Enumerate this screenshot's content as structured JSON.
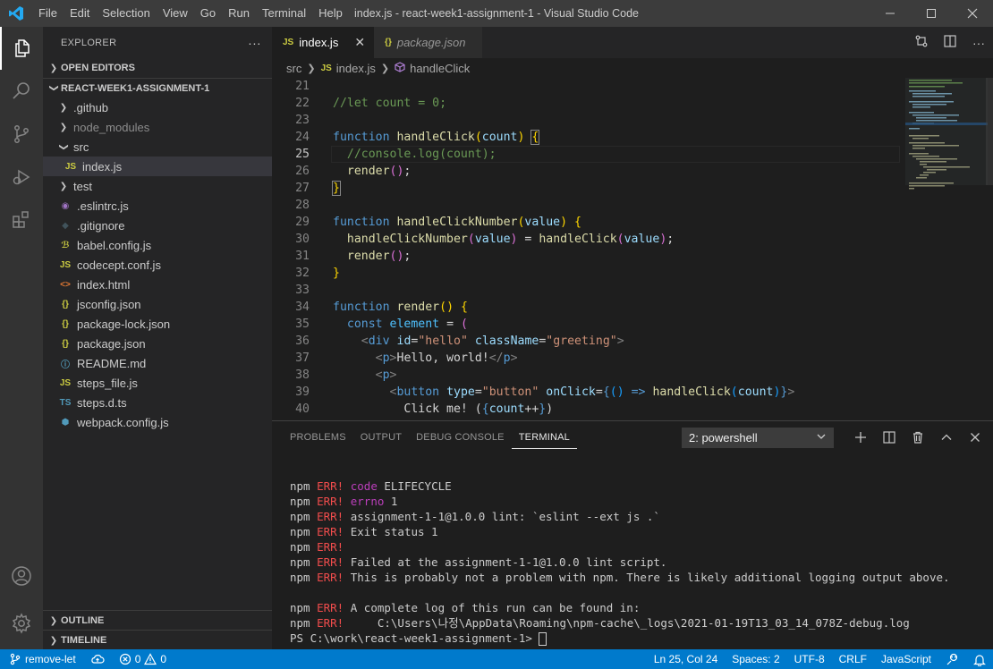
{
  "window": {
    "title": "index.js - react-week1-assignment-1 - Visual Studio Code",
    "menu": [
      "File",
      "Edit",
      "Selection",
      "View",
      "Go",
      "Run",
      "Terminal",
      "Help"
    ]
  },
  "sidebar": {
    "header": "EXPLORER",
    "more": "···",
    "open_editors": "OPEN EDITORS",
    "project": "REACT-WEEK1-ASSIGNMENT-1",
    "tree": [
      {
        "label": ".github",
        "icon": "chevron-right",
        "indent": 1
      },
      {
        "label": "node_modules",
        "icon": "chevron-right",
        "indent": 1,
        "dim": true
      },
      {
        "label": "src",
        "icon": "chevron-down",
        "indent": 1
      },
      {
        "label": "index.js",
        "icon": "JS",
        "indent": 2,
        "selected": true
      },
      {
        "label": "test",
        "icon": "chevron-right",
        "indent": 1
      },
      {
        "label": ".eslintrc.js",
        "icon": "eslint",
        "indent": 1
      },
      {
        "label": ".gitignore",
        "icon": "git",
        "indent": 1
      },
      {
        "label": "babel.config.js",
        "icon": "babel",
        "indent": 1
      },
      {
        "label": "codecept.conf.js",
        "icon": "JS",
        "indent": 1
      },
      {
        "label": "index.html",
        "icon": "html",
        "indent": 1
      },
      {
        "label": "jsconfig.json",
        "icon": "json",
        "indent": 1
      },
      {
        "label": "package-lock.json",
        "icon": "json",
        "indent": 1
      },
      {
        "label": "package.json",
        "icon": "json",
        "indent": 1
      },
      {
        "label": "README.md",
        "icon": "info",
        "indent": 1
      },
      {
        "label": "steps_file.js",
        "icon": "JS",
        "indent": 1
      },
      {
        "label": "steps.d.ts",
        "icon": "TS",
        "indent": 1
      },
      {
        "label": "webpack.config.js",
        "icon": "webpack",
        "indent": 1
      }
    ],
    "outline": "OUTLINE",
    "timeline": "TIMELINE"
  },
  "tabs": [
    {
      "label": "index.js",
      "active": true
    },
    {
      "label": "package.json",
      "active": false
    }
  ],
  "breadcrumbs": [
    "src",
    "index.js",
    "handleClick"
  ],
  "editor": {
    "current_line": 25,
    "lines": [
      {
        "n": "21",
        "html": ""
      },
      {
        "n": "22",
        "html": "<span class=\"cm\">//let count = 0;</span>"
      },
      {
        "n": "23",
        "html": ""
      },
      {
        "n": "24",
        "html": "<span class=\"kw\">function</span> <span class=\"fn\">handleClick</span><span class=\"br\">(</span><span class=\"pm\">count</span><span class=\"br\">)</span> <span class=\"br\" style=\"outline:1px solid #888\">{</span>"
      },
      {
        "n": "25",
        "html": "  <span class=\"cm\">//console.log(count);</span>"
      },
      {
        "n": "26",
        "html": "  <span class=\"fn\">render</span><span class=\"br2\">()</span>;"
      },
      {
        "n": "27",
        "html": "<span class=\"br\" style=\"outline:1px solid #888\">}</span>"
      },
      {
        "n": "28",
        "html": ""
      },
      {
        "n": "29",
        "html": "<span class=\"kw\">function</span> <span class=\"fn\">handleClickNumber</span><span class=\"br\">(</span><span class=\"pm\">value</span><span class=\"br\">)</span> <span class=\"br\">{</span>"
      },
      {
        "n": "30",
        "html": "  <span class=\"fn\">handleClickNumber</span><span class=\"br2\">(</span><span class=\"pm\">value</span><span class=\"br2\">)</span> = <span class=\"fn\">handleClick</span><span class=\"br2\">(</span><span class=\"pm\">value</span><span class=\"br2\">)</span>;"
      },
      {
        "n": "31",
        "html": "  <span class=\"fn\">render</span><span class=\"br2\">()</span>;"
      },
      {
        "n": "32",
        "html": "<span class=\"br\">}</span>"
      },
      {
        "n": "33",
        "html": ""
      },
      {
        "n": "34",
        "html": "<span class=\"kw\">function</span> <span class=\"fn\">render</span><span class=\"br\">()</span> <span class=\"br\">{</span>"
      },
      {
        "n": "35",
        "html": "  <span class=\"kw\">const</span> <span class=\"pm\" style=\"color:#4fc1ff\">element</span> = <span class=\"br2\">(</span>"
      },
      {
        "n": "36",
        "html": "    <span class=\"pu\">&lt;</span><span class=\"tg\">div</span> <span class=\"at\">id</span>=<span class=\"st\">\"hello\"</span> <span class=\"at\">className</span>=<span class=\"st\">\"greeting\"</span><span class=\"pu\">&gt;</span>"
      },
      {
        "n": "37",
        "html": "      <span class=\"pu\">&lt;</span><span class=\"tg\">p</span><span class=\"pu\">&gt;</span>Hello, world!<span class=\"pu\">&lt;/</span><span class=\"tg\">p</span><span class=\"pu\">&gt;</span>"
      },
      {
        "n": "38",
        "html": "      <span class=\"pu\">&lt;</span><span class=\"tg\">p</span><span class=\"pu\">&gt;</span>"
      },
      {
        "n": "39",
        "html": "        <span class=\"pu\">&lt;</span><span class=\"tg\">button</span> <span class=\"at\">type</span>=<span class=\"st\">\"button\"</span> <span class=\"at\">onClick</span>=<span class=\"kw\">{</span><span class=\"br3\">()</span> <span class=\"kw\">=&gt;</span> <span class=\"fn\">handleClick</span><span class=\"br3\">(</span><span class=\"pm\">count</span><span class=\"br3\">)</span><span class=\"kw\">}</span><span class=\"pu\">&gt;</span>"
      },
      {
        "n": "40",
        "html": "          Click me! (<span class=\"kw\">{</span><span class=\"pm\">count</span>++<span class=\"kw\">}</span>)"
      }
    ]
  },
  "panel": {
    "tabs": [
      "PROBLEMS",
      "OUTPUT",
      "DEBUG CONSOLE",
      "TERMINAL"
    ],
    "active_tab": "TERMINAL",
    "terminal_select": "2: powershell",
    "terminal_lines": [
      {
        "p": "npm",
        "e": "ERR!",
        "m": "code",
        "t": " ELIFECYCLE"
      },
      {
        "p": "npm",
        "e": "ERR!",
        "m": "errno",
        "t": " 1"
      },
      {
        "p": "npm",
        "e": "ERR!",
        "m": "",
        "t": "assignment-1-1@1.0.0 lint: `eslint --ext js .`"
      },
      {
        "p": "npm",
        "e": "ERR!",
        "m": "",
        "t": "Exit status 1"
      },
      {
        "p": "npm",
        "e": "ERR!",
        "m": "",
        "t": ""
      },
      {
        "p": "npm",
        "e": "ERR!",
        "m": "",
        "t": "Failed at the assignment-1-1@1.0.0 lint script."
      },
      {
        "p": "npm",
        "e": "ERR!",
        "m": "",
        "t": "This is probably not a problem with npm. There is likely additional logging output above."
      },
      {
        "p": "",
        "e": "",
        "m": "",
        "t": ""
      },
      {
        "p": "npm",
        "e": "ERR!",
        "m": "",
        "t": "A complete log of this run can be found in:"
      },
      {
        "p": "npm",
        "e": "ERR!",
        "m": "",
        "t": "    C:\\Users\\나정\\AppData\\Roaming\\npm-cache\\_logs\\2021-01-19T13_03_14_078Z-debug.log"
      }
    ],
    "prompt": "PS C:\\work\\react-week1-assignment-1> "
  },
  "statusbar": {
    "branch": "remove-let",
    "errors": "0",
    "warnings": "0",
    "position": "Ln 25, Col 24",
    "spaces": "Spaces: 2",
    "encoding": "UTF-8",
    "eol": "CRLF",
    "language": "JavaScript"
  }
}
